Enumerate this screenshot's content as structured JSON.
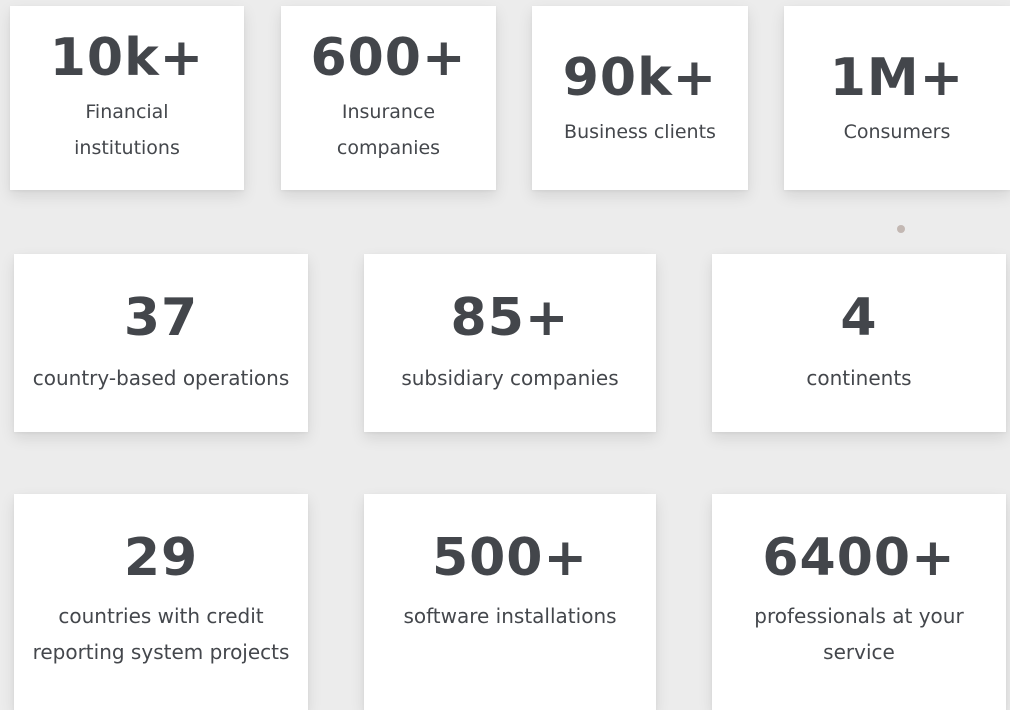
{
  "stats": {
    "row1": [
      {
        "value": "10k+",
        "label_lines": [
          "Financial",
          "institutions"
        ]
      },
      {
        "value": "600+",
        "label_lines": [
          "Insurance",
          "companies"
        ]
      },
      {
        "value": "90k+",
        "label_lines": [
          "Business clients"
        ]
      },
      {
        "value": "1M+",
        "label_lines": [
          "Consumers"
        ]
      }
    ],
    "row2": [
      {
        "value": "37",
        "label_lines": [
          "country-based operations"
        ]
      },
      {
        "value": "85+",
        "label_lines": [
          "subsidiary companies"
        ]
      },
      {
        "value": "4",
        "label_lines": [
          "continents"
        ]
      }
    ],
    "row3": [
      {
        "value": "29",
        "label_lines": [
          "countries with credit",
          "reporting system projects"
        ]
      },
      {
        "value": "500+",
        "label_lines": [
          "software installations"
        ]
      },
      {
        "value": "6400+",
        "label_lines": [
          "professionals at your",
          "service"
        ]
      }
    ]
  },
  "colors": {
    "background": "#ececec",
    "card": "#ffffff",
    "text": "#44474c",
    "dot": "#c3b8b3"
  }
}
